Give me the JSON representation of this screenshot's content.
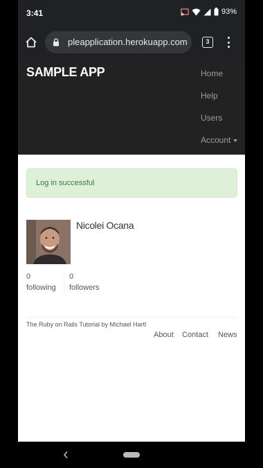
{
  "status_bar": {
    "time": "3:41",
    "battery": "93%",
    "icons": [
      "cast-icon",
      "wifi-icon",
      "signal-icon",
      "battery-icon"
    ]
  },
  "browser": {
    "url": "pleapplication.herokuapp.com",
    "tab_count": "3"
  },
  "app": {
    "brand": "SAMPLE APP",
    "nav": {
      "home": "Home",
      "help": "Help",
      "users": "Users",
      "account": "Account"
    }
  },
  "flash": {
    "message": "Log in successful"
  },
  "profile": {
    "name": "Nicolei Ocana",
    "following_count": "0",
    "following_label": "following",
    "followers_count": "0",
    "followers_label": "followers"
  },
  "footer": {
    "credit": "The Ruby on Rails Tutorial by Michael Hartl",
    "links": {
      "about": "About",
      "contact": "Contact",
      "news": "News"
    }
  },
  "colors": {
    "header_bg": "#222222",
    "alert_bg": "#dff0d8",
    "alert_text": "#3c763d",
    "chrome_bg": "#202124"
  }
}
